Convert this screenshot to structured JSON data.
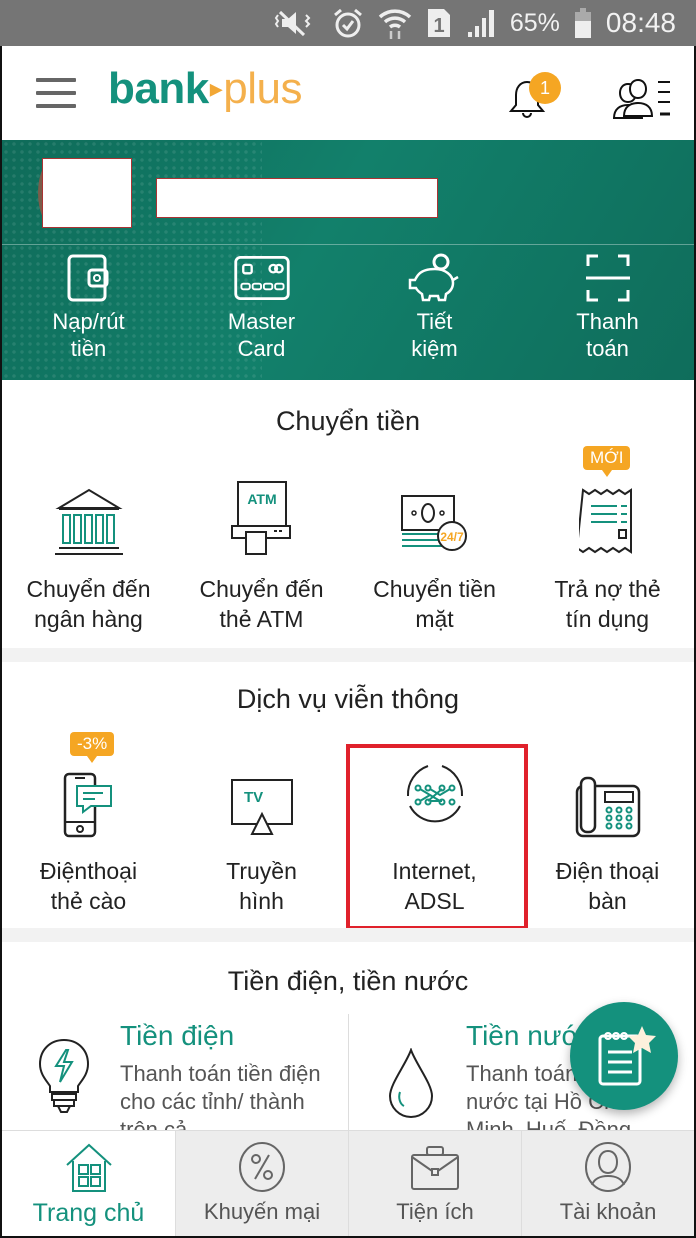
{
  "status_bar": {
    "battery_percent": "65%",
    "time": "08:48",
    "sim_slot": "1",
    "icons": [
      "mute-icon",
      "alarm-icon",
      "wifi-icon",
      "sim-icon",
      "signal-icon",
      "battery-icon"
    ]
  },
  "app_bar": {
    "logo_part1": "bank",
    "logo_arrow": "▸",
    "logo_part2": "plus",
    "notification_count": "1",
    "colors": {
      "brand_green": "#14917d",
      "brand_orange": "#f4b04c"
    }
  },
  "quick_actions": [
    {
      "label_line1": "Nạp/rút",
      "label_line2": "tiền",
      "icon": "wallet-icon"
    },
    {
      "label_line1": "Master",
      "label_line2": "Card",
      "icon": "credit-card-icon"
    },
    {
      "label_line1": "Tiết",
      "label_line2": "kiệm",
      "icon": "piggy-bank-icon"
    },
    {
      "label_line1": "Thanh",
      "label_line2": "toán",
      "icon": "scan-icon"
    }
  ],
  "transfer": {
    "title": "Chuyển tiền",
    "items": [
      {
        "line1": "Chuyển đến",
        "line2": "ngân hàng",
        "icon": "bank-icon"
      },
      {
        "line1": "Chuyển đến",
        "line2": "thẻ ATM",
        "icon": "atm-icon",
        "icon_text": "ATM"
      },
      {
        "line1": "Chuyển tiền",
        "line2": "mặt",
        "icon": "cash-24-7-icon",
        "icon_text": "24/7"
      },
      {
        "line1": "Trả nợ thẻ",
        "line2": "tín dụng",
        "icon": "receipt-icon",
        "badge": "MỚI"
      }
    ]
  },
  "telecom": {
    "title": "Dịch vụ viễn thông",
    "items": [
      {
        "line1": "Điệnthoại",
        "line2": "thẻ cào",
        "icon": "phone-card-icon",
        "badge": "-3%"
      },
      {
        "line1": "Truyền",
        "line2": "hình",
        "icon": "tv-icon",
        "icon_text": "TV"
      },
      {
        "line1": "Internet,",
        "line2": "ADSL",
        "icon": "internet-icon",
        "highlighted": true
      },
      {
        "line1": "Điện thoại",
        "line2": "bàn",
        "icon": "desk-phone-icon"
      }
    ]
  },
  "utilities": {
    "title": "Tiền điện, tiền nước",
    "items": [
      {
        "title": "Tiền điện",
        "description": "Thanh toán tiền điện cho các tỉnh/ thành trên cả",
        "icon": "lightbulb-icon"
      },
      {
        "title": "Tiền nước",
        "description": "Thanh toán tiền nước tại Hồ Chí Minh, Huế, Đồng",
        "icon": "water-drop-icon"
      }
    ]
  },
  "fab": {
    "icon": "notepad-star-icon"
  },
  "tabs": [
    {
      "label": "Trang chủ",
      "icon": "home-icon",
      "active": true
    },
    {
      "label": "Khuyến mại",
      "icon": "percent-icon",
      "active": false
    },
    {
      "label": "Tiện ích",
      "icon": "briefcase-icon",
      "active": false
    },
    {
      "label": "Tài khoản",
      "icon": "user-icon",
      "active": false
    }
  ]
}
